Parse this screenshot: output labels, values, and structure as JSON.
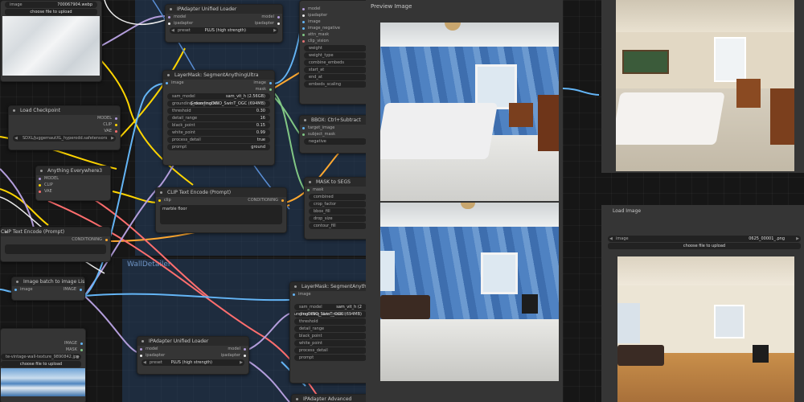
{
  "groups": {
    "wall_detailer": "WallDetailer"
  },
  "nodes": {
    "load_image_top": {
      "image_label": "image",
      "image_value": "700067904.webp",
      "upload_label": "choose file to upload"
    },
    "ipadapter_unified_top": {
      "title": "IPAdapter Unified Loader",
      "in1": "model",
      "in2": "ipadapter",
      "out1": "model",
      "out2": "ipadapter",
      "preset_label": "preset",
      "preset_value": "PLUS (high strength)"
    },
    "load_checkpoint": {
      "title": "Load Checkpoint",
      "out1": "MODEL",
      "out2": "CLIP",
      "out3": "VAE",
      "ckpt_value": "SDXL/juggernautXL_hyperodd.safetensors"
    },
    "anything_everywhere": {
      "title": "Anything Everywhere3",
      "in1": "MODEL",
      "in2": "CLIP",
      "in3": "VAE"
    },
    "segment_top": {
      "title": "LayerMask: SegmentAnythingUltra",
      "in1": "image",
      "out1": "image",
      "out2": "mask",
      "widgets": [
        {
          "label": "sam_model",
          "value": "sam_vit_h (2.56GB)"
        },
        {
          "label": "grounding_dino_model",
          "value": "GroundingDINO_SwinT_OGC (694MB)"
        },
        {
          "label": "threshold",
          "value": "0.30"
        },
        {
          "label": "detail_range",
          "value": "16"
        },
        {
          "label": "black_point",
          "value": "0.15"
        },
        {
          "label": "white_point",
          "value": "0.99"
        },
        {
          "label": "process_detail",
          "value": "true"
        },
        {
          "label": "prompt",
          "value": "ground"
        }
      ]
    },
    "ipadapter_adv_top": {
      "ins": [
        "model",
        "ipadapter",
        "image",
        "image_negative",
        "attn_mask",
        "clip_vision"
      ],
      "widgets": [
        "weight",
        "weight_type",
        "combine_embeds",
        "start_at",
        "end_at",
        "embeds_scaling"
      ]
    },
    "bbox_subtract": {
      "title": "BBOX: Ctrl+Subtract",
      "in1": "target_image",
      "in2": "subject_mask",
      "w1": "negative"
    },
    "clip_text_encode": {
      "title": "CLIP Text Encode (Prompt)",
      "in1": "clip",
      "out1": "CONDITIONING",
      "text": "marble floor"
    },
    "clip_text_encode_left": {
      "title": "CLIP Text Encode (Prompt)",
      "out1": "CONDITIONING"
    },
    "mask_to_segs": {
      "title": "MASK to SEGS",
      "in1": "mask",
      "widgets": [
        "combined",
        "crop_factor",
        "bbox_fill",
        "drop_size",
        "contour_fill"
      ]
    },
    "image_batch": {
      "title": "Image batch to image List",
      "in1": "image",
      "out1": "IMAGE"
    },
    "load_image_left": {
      "out1": "IMAGE",
      "out2": "MASK",
      "image_label": "image",
      "image_value": "te-vintage-wall-texture_9890842.jpg",
      "upload_label": "choose file to upload"
    },
    "ipadapter_unified_bottom": {
      "title": "IPAdapter Unified Loader",
      "in1": "model",
      "in2": "ipadapter",
      "out1": "model",
      "out2": "ipadapter",
      "preset_label": "preset",
      "preset_value": "PLUS (high strength)"
    },
    "segment_bottom": {
      "title": "LayerMask: SegmentAnythingU",
      "in1": "image",
      "widgets": [
        {
          "label": "sam_model",
          "value": "sam_vit_h (2"
        },
        {
          "label": "grounding_dino_model",
          "value": "GroundingDINO_SwinT_OGC (694MB)"
        },
        {
          "label": "threshold",
          "value": ""
        },
        {
          "label": "detail_range",
          "value": ""
        },
        {
          "label": "black_point",
          "value": ""
        },
        {
          "label": "white_point",
          "value": ""
        },
        {
          "label": "process_detail",
          "value": ""
        },
        {
          "label": "prompt",
          "value": ""
        }
      ]
    },
    "ipadapter_adv_bottom": {
      "title": "IPAdapter Advanced"
    },
    "preview_image": {
      "title": "Preview Image"
    },
    "load_image_right": {
      "title": "Load Image",
      "image_label": "image",
      "image_value": "0625_00001_.png",
      "upload_label": "choose file to upload"
    }
  },
  "colors": {
    "model_wire": "#b39ddb",
    "clip_wire": "#ffd500",
    "vae_wire": "#ff6e6e",
    "image_wire": "#64b5f6",
    "mask_wire": "#81c784",
    "conditioning_wire": "#ffa931",
    "group_bg": "#28466e"
  }
}
